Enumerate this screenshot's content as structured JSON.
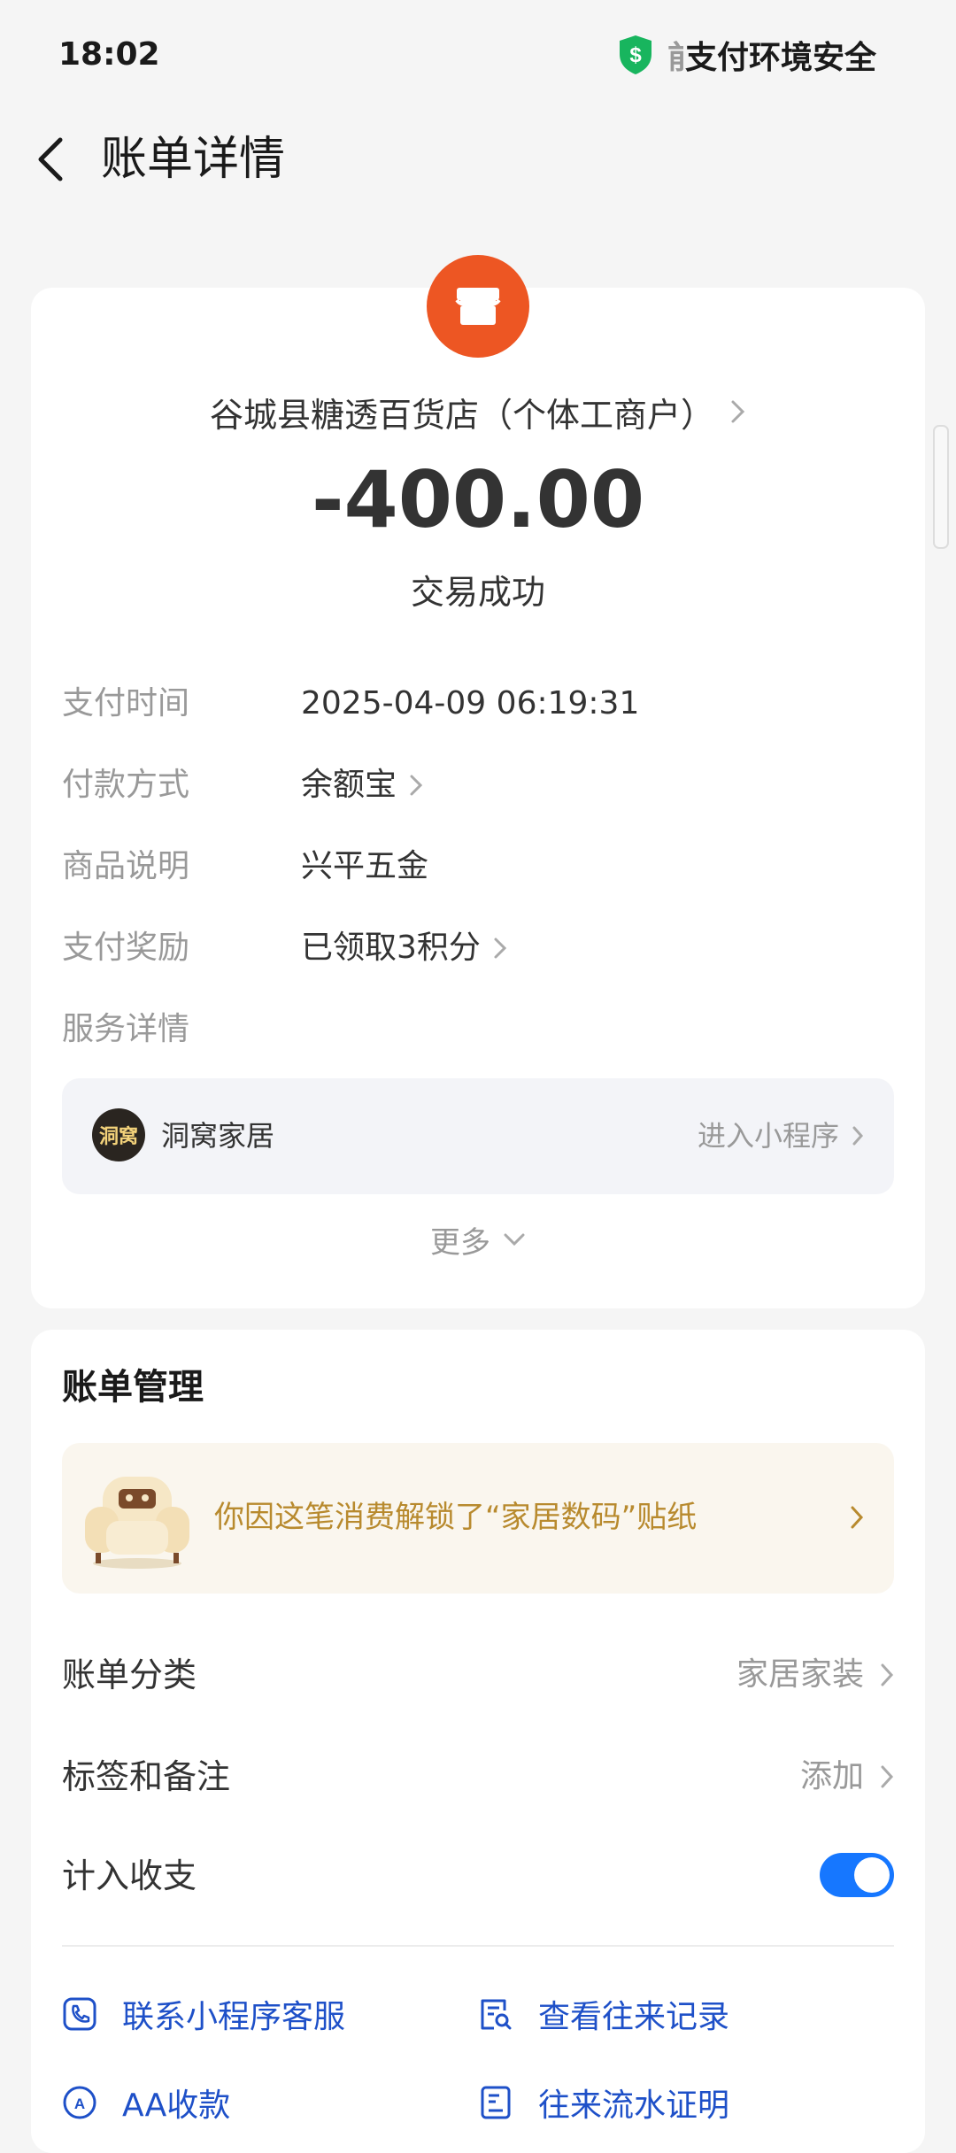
{
  "status_bar": {
    "time": "18:02",
    "security_cut": "前",
    "security_text": "支付环境安全"
  },
  "header": {
    "title": "账单详情"
  },
  "bill": {
    "merchant": "谷城县糖透百货店（个体工商户）",
    "amount": "-400.00",
    "status": "交易成功",
    "rows": [
      {
        "label": "支付时间",
        "value": "2025-04-09 06:19:31"
      },
      {
        "label": "付款方式",
        "value": "余额宝"
      },
      {
        "label": "商品说明",
        "value": "兴平五金"
      },
      {
        "label": "支付奖励",
        "value": "已领取3积分"
      }
    ],
    "service_label": "服务详情",
    "service": {
      "logo_text": "洞窝",
      "name": "洞窝家居",
      "enter": "进入小程序"
    },
    "more": "更多"
  },
  "manage": {
    "title": "账单管理",
    "sticker_text": "你因这笔消费解锁了“家居数码”贴纸",
    "category_label": "账单分类",
    "category_value": "家居家装",
    "tag_label": "标签和备注",
    "tag_value": "添加",
    "count_label": "计入收支",
    "count_enabled": true,
    "actions": {
      "contact": "联系小程序客服",
      "records": "查看往来记录",
      "aa": "AA收款",
      "proof": "往来流水证明"
    }
  },
  "colors": {
    "accent": "#1677ff",
    "link": "#1e50c8",
    "merchant_logo": "#ed5623",
    "sticker_text": "#b88a2e",
    "shield": "#18b55e"
  }
}
